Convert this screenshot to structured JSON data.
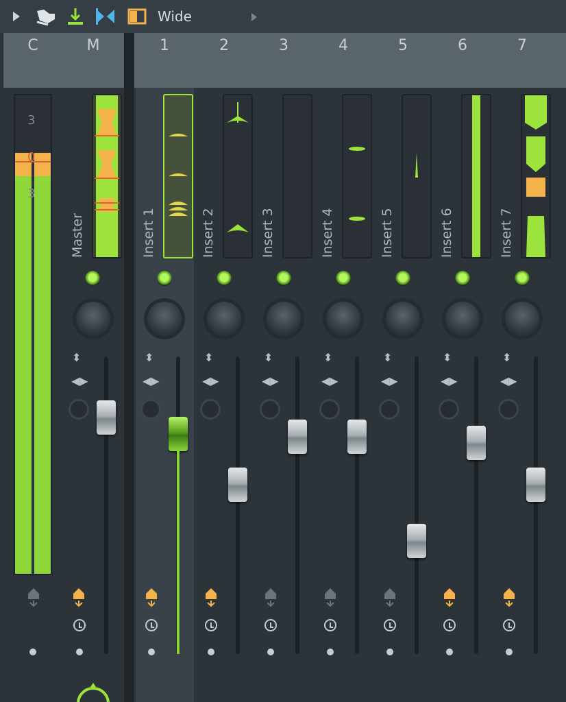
{
  "toolbar": {
    "play_icon": "play-triangle-icon",
    "wide_label": "Wide",
    "arrow_icon": "arrow-right-icon"
  },
  "columns": {
    "c": "C",
    "m": "M",
    "inserts": [
      "1",
      "2",
      "3",
      "4",
      "5",
      "6",
      "7"
    ]
  },
  "master": {
    "label": "Master",
    "scale": [
      "3",
      "0",
      "3"
    ],
    "level_fraction": 0.88
  },
  "strips": [
    {
      "label": "Insert 1",
      "fader_level": 0.74,
      "selected": true
    },
    {
      "label": "Insert 2",
      "fader_level": 0.57
    },
    {
      "label": "Insert 3",
      "fader_level": 0.73
    },
    {
      "label": "Insert 4",
      "fader_level": 0.73
    },
    {
      "label": "Insert 5",
      "fader_level": 0.38
    },
    {
      "label": "Insert 6",
      "fader_level": 0.71
    },
    {
      "label": "Insert 7",
      "fader_level": 0.57
    }
  ],
  "colors": {
    "accent_green": "#9ce43c",
    "peak_orange": "#f3b34a",
    "panel": "#2c3339",
    "header": "#5a646b"
  }
}
